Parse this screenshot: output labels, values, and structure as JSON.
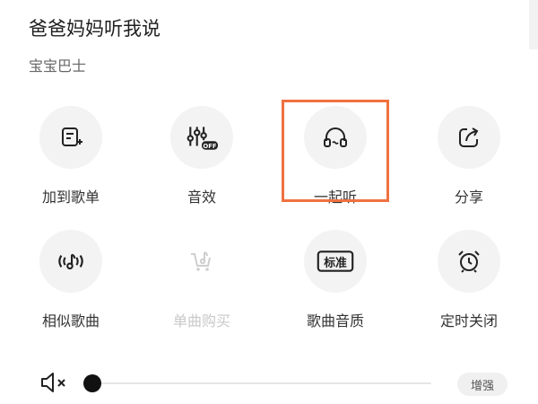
{
  "song": {
    "title": "爸爸妈妈听我说",
    "artist": "宝宝巴士"
  },
  "actions": [
    {
      "label": "加到歌单",
      "icon": "add-to-playlist-icon",
      "enabled": true
    },
    {
      "label": "音效",
      "icon": "equalizer-off-icon",
      "badge": "OFF",
      "enabled": true
    },
    {
      "label": "一起听",
      "icon": "headphones-icon",
      "enabled": true,
      "highlighted": true
    },
    {
      "label": "分享",
      "icon": "share-icon",
      "enabled": true
    },
    {
      "label": "相似歌曲",
      "icon": "similar-songs-icon",
      "enabled": true
    },
    {
      "label": "单曲购买",
      "icon": "buy-song-icon",
      "enabled": false
    },
    {
      "label": "歌曲音质",
      "icon": "quality-standard-icon",
      "badge": "标准",
      "enabled": true
    },
    {
      "label": "定时关闭",
      "icon": "alarm-clock-icon",
      "enabled": true
    }
  ],
  "volume": {
    "level": 0,
    "muted": true,
    "enhance_label": "增强"
  },
  "colors": {
    "highlight": "#f07040",
    "disabled": "#c8c8c8"
  }
}
